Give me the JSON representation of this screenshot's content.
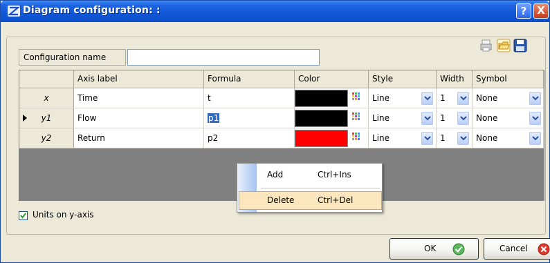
{
  "window": {
    "title": "Diagram configuration:  :",
    "help_label": "?",
    "close_label": "X"
  },
  "config": {
    "name_label": "Configuration name",
    "name_value": ""
  },
  "grid": {
    "columns": [
      "Axis label",
      "Formula",
      "Color",
      "Style",
      "Width",
      "Symbol"
    ],
    "rows": [
      {
        "id": "x",
        "axis_label": "Time",
        "formula": "t",
        "color": "#000000",
        "style": "Line",
        "width": "1",
        "symbol": "None"
      },
      {
        "id": "y1",
        "axis_label": "Flow",
        "formula": "p1",
        "color": "#000000",
        "style": "Line",
        "width": "1",
        "symbol": "None",
        "current": true
      },
      {
        "id": "y2",
        "axis_label": "Return",
        "formula": "p2",
        "color": "#ff0000",
        "style": "Line",
        "width": "1",
        "symbol": "None"
      }
    ]
  },
  "context_menu": {
    "items": [
      {
        "label": "Add",
        "shortcut": "Ctrl+Ins"
      },
      {
        "label": "Delete",
        "shortcut": "Ctrl+Del",
        "highlighted": true
      }
    ]
  },
  "options": {
    "units_on_y_axis": "Units on y-axis",
    "units_checked": true
  },
  "buttons": {
    "ok": "OK",
    "cancel": "Cancel"
  },
  "icons": [
    "app-diagram-icon",
    "print-icon",
    "open-folder-icon",
    "save-disk-icon",
    "palette-icon",
    "dropdown-arrow-icon",
    "check-icon",
    "cancel-icon"
  ],
  "colors": {
    "titlebar": "#1158d8",
    "highlight": "#316ac5",
    "menu_hover": "#fbe6bd"
  }
}
